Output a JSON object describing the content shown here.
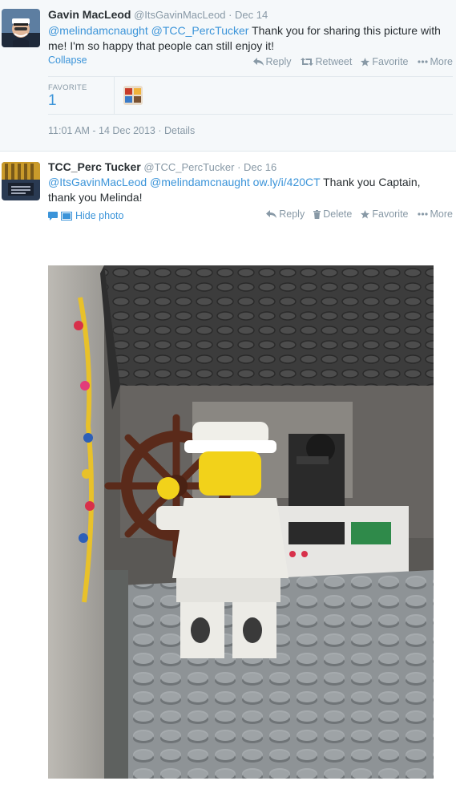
{
  "tweets": [
    {
      "fullname": "Gavin MacLeod",
      "screenname": "@ItsGavinMacLeod",
      "date": "Dec 14",
      "text_parts": [
        {
          "t": "@melindamcnaught",
          "c": "mention"
        },
        {
          "t": " ",
          "c": ""
        },
        {
          "t": "@TCC_PercTucker",
          "c": "mention"
        },
        {
          "t": " Thank you for sharing this picture with me! I'm so happy that people can still enjoy it!",
          "c": ""
        }
      ],
      "collapse_label": "Collapse",
      "actions": {
        "reply": "Reply",
        "retweet": "Retweet",
        "favorite": "Favorite",
        "more": "More"
      },
      "stats": {
        "label": "FAVORITE",
        "count": "1"
      },
      "timestamp": "11:01 AM - 14 Dec 2013 · Details"
    },
    {
      "fullname": "TCC_Perc Tucker",
      "screenname": "@TCC_PercTucker",
      "date": "Dec 16",
      "text_parts": [
        {
          "t": "@ItsGavinMacLeod",
          "c": "mention"
        },
        {
          "t": " ",
          "c": ""
        },
        {
          "t": "@melindamcnaught",
          "c": "mention"
        },
        {
          "t": " ",
          "c": ""
        },
        {
          "t": "ow.ly/i/420CT",
          "c": "link"
        },
        {
          "t": " Thank you Captain, thank you Melinda!",
          "c": ""
        }
      ],
      "hide_photo_label": "Hide photo",
      "actions": {
        "reply": "Reply",
        "delete": "Delete",
        "favorite": "Favorite",
        "more": "More"
      }
    }
  ],
  "separator": "·",
  "colors": {
    "link": "#3b94d9",
    "muted": "#8899a6",
    "text": "#292f33",
    "bg_expanded": "#f5f8fa"
  }
}
